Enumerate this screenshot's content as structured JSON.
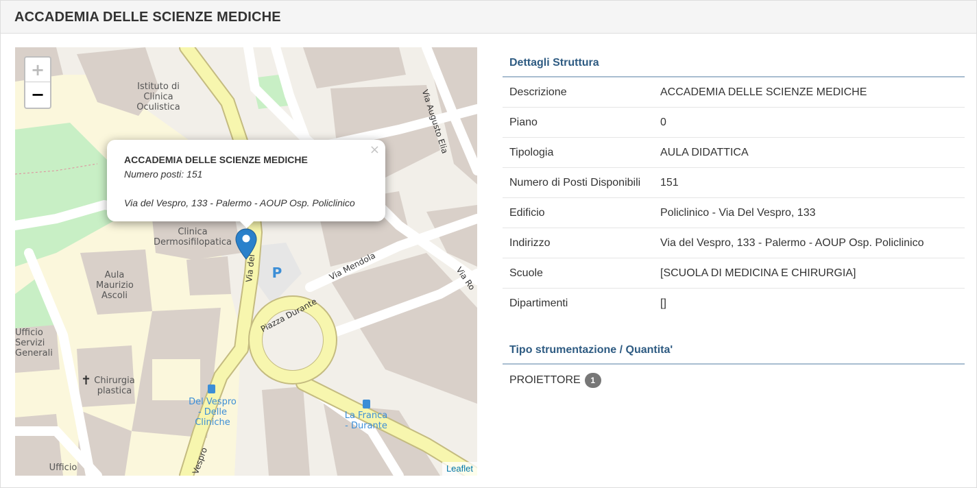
{
  "header": {
    "title": "ACCADEMIA DELLE SCIENZE MEDICHE"
  },
  "map": {
    "zoom_in_label": "+",
    "zoom_out_label": "−",
    "attribution": "Leaflet",
    "popup": {
      "close_label": "×",
      "title": "ACCADEMIA DELLE SCIENZE MEDICHE",
      "seats": "Numero posti: 151",
      "address": "Via del Vespro, 133 - Palermo - AOUP Osp. Policlinico"
    },
    "labels": {
      "istituto": "Istituto di Clinica Oculistica",
      "clinica": "Clinica Dermosifilopatica",
      "aula": "Aula Maurizio Ascoli",
      "ufficio_servizi": "Ufficio Servizi Generali",
      "chirurgia": "Chirurgia plastica",
      "del_vespro_stop": "Del Vespro - Delle Cliniche",
      "la_franca_stop": "La Franca - Durante",
      "ufficio": "Ufficio",
      "parking": "P"
    },
    "streets": {
      "via_augusto_elia": "Via Augusto Elia",
      "via_mendola": "Via Mendola",
      "via_ro": "Via Ro",
      "piazza_durante": "Piazza Durante",
      "via_del_vespro": "Via del",
      "vespro_bottom": "Vespro"
    }
  },
  "details": {
    "section_title": "Dettagli Struttura",
    "rows": [
      {
        "label": "Descrizione",
        "value": "ACCADEMIA DELLE SCIENZE MEDICHE"
      },
      {
        "label": "Piano",
        "value": "0"
      },
      {
        "label": "Tipologia",
        "value": "AULA DIDATTICA"
      },
      {
        "label": "Numero di Posti Disponibili",
        "value": "151"
      },
      {
        "label": "Edificio",
        "value": "Policlinico - Via Del Vespro, 133"
      },
      {
        "label": "Indirizzo",
        "value": "Via del Vespro, 133 - Palermo - AOUP Osp. Policlinico"
      },
      {
        "label": "Scuole",
        "value": "[SCUOLA DI MEDICINA E CHIRURGIA]"
      },
      {
        "label": "Dipartimenti",
        "value": "[]"
      }
    ],
    "equipment_title": "Tipo strumentazione / Quantita'",
    "equipment": [
      {
        "name": "PROIETTORE",
        "quantity": "1"
      }
    ]
  }
}
